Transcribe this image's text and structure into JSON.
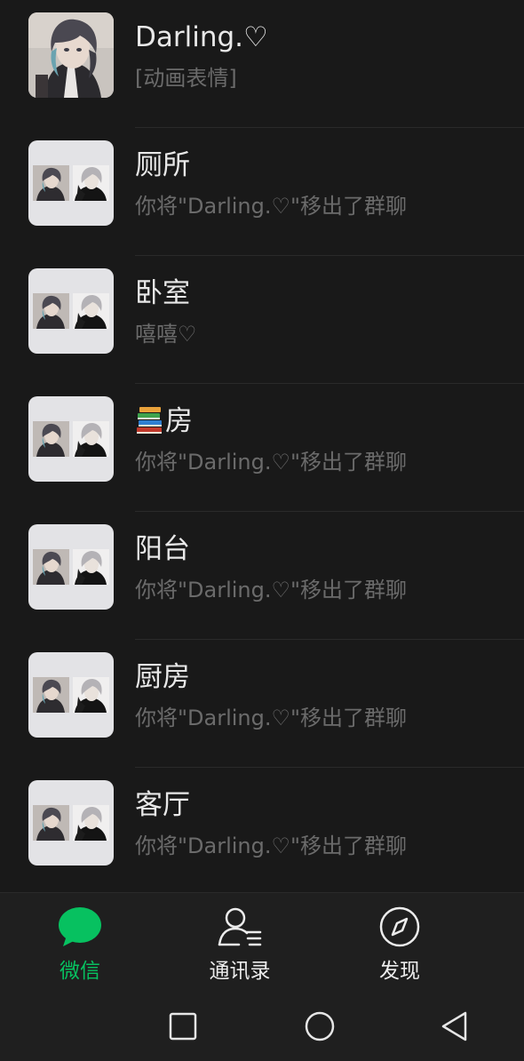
{
  "chats": [
    {
      "name": "Darling.♡",
      "preview": "[动画表情]",
      "avatar": "single-portrait"
    },
    {
      "name": "厕所",
      "preview": "你将\"Darling.♡\"移出了群聊",
      "avatar": "group-grid"
    },
    {
      "name": "卧室",
      "preview": "嘻嘻♡",
      "avatar": "group-grid"
    },
    {
      "name": "房",
      "name_emoji": "books-icon",
      "preview": "你将\"Darling.♡\"移出了群聊",
      "avatar": "group-grid"
    },
    {
      "name": "阳台",
      "preview": "你将\"Darling.♡\"移出了群聊",
      "avatar": "group-grid"
    },
    {
      "name": "厨房",
      "preview": "你将\"Darling.♡\"移出了群聊",
      "avatar": "group-grid"
    },
    {
      "name": "客厅",
      "preview": "你将\"Darling.♡\"移出了群聊",
      "avatar": "group-grid"
    }
  ],
  "tabs": [
    {
      "label": "微信",
      "icon": "chat-bubble-icon",
      "active": true
    },
    {
      "label": "通讯录",
      "icon": "contacts-icon",
      "active": false
    },
    {
      "label": "发现",
      "icon": "compass-icon",
      "active": false
    }
  ],
  "system_nav": {
    "buttons": [
      "recent-apps-icon",
      "home-icon",
      "back-icon"
    ]
  },
  "colors": {
    "background": "#191919",
    "accent": "#07c160",
    "name_text": "#e8e8e8",
    "preview_text": "#6b6b6b"
  }
}
